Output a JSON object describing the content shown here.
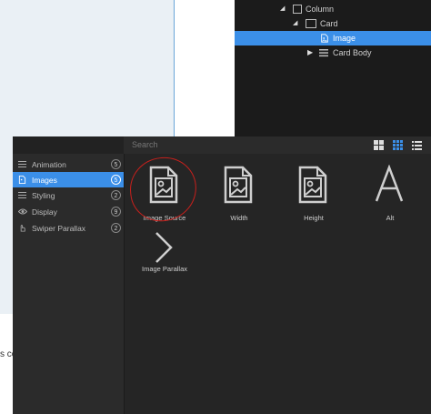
{
  "navigator": {
    "items": [
      {
        "label": "Column"
      },
      {
        "label": "Card"
      },
      {
        "label": "Image"
      },
      {
        "label": "Card Body"
      }
    ]
  },
  "canvas": {
    "cutoff_text": "s co"
  },
  "panel": {
    "search_placeholder": "Search",
    "sidebar": [
      {
        "label": "Animation",
        "count": "5",
        "icon": "list-icon"
      },
      {
        "label": "Images",
        "count": "5",
        "icon": "image-file-icon"
      },
      {
        "label": "Styling",
        "count": "2",
        "icon": "list-icon"
      },
      {
        "label": "Display",
        "count": "9",
        "icon": "eye-icon"
      },
      {
        "label": "Swiper Parallax",
        "count": "2",
        "icon": "hand-icon"
      }
    ],
    "tiles": [
      {
        "label": "Image Source",
        "icon": "image-file-icon"
      },
      {
        "label": "Width",
        "icon": "image-file-icon"
      },
      {
        "label": "Height",
        "icon": "image-file-icon"
      },
      {
        "label": "Alt",
        "icon": "letter-a-icon"
      },
      {
        "label": "Image Parallax",
        "icon": "chevron-right-icon"
      }
    ]
  },
  "colors": {
    "accent": "#3b8fe8",
    "annotation": "#c8201c",
    "panel_bg": "#222222"
  }
}
